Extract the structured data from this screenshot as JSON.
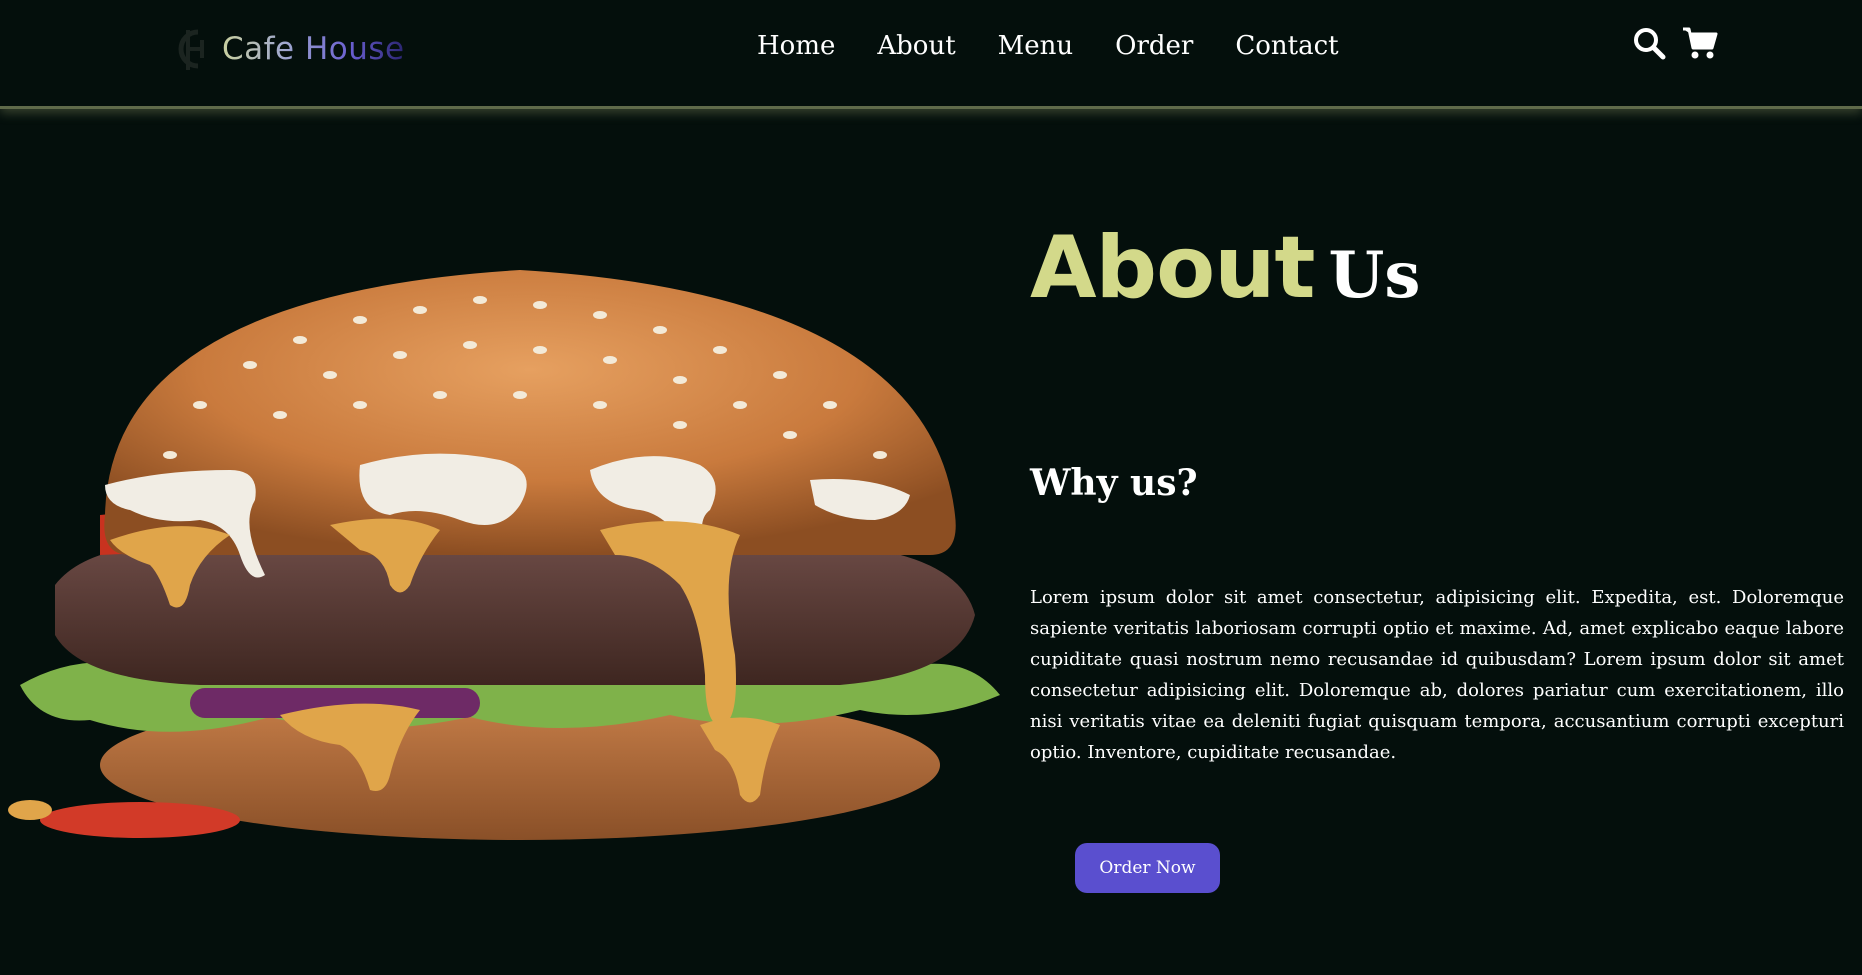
{
  "brand": {
    "name": "Cafe House"
  },
  "nav": {
    "links": [
      {
        "label": "Home"
      },
      {
        "label": "About"
      },
      {
        "label": "Menu"
      },
      {
        "label": "Order"
      },
      {
        "label": "Contact"
      }
    ],
    "icons": [
      "search-icon",
      "cart-icon"
    ]
  },
  "about": {
    "title_bold": "About",
    "title_rest": "Us",
    "subtitle": "Why us?",
    "paragraph": "Lorem ipsum dolor sit amet consectetur, adipisicing elit. Expedita, est. Doloremque sapiente veritatis laboriosam corrupti optio et maxime. Ad, amet explicabo eaque labore cupiditate quasi nostrum nemo recusandae id quibusdam? Lorem ipsum dolor sit amet consectetur adipisicing elit. Doloremque ab, dolores pariatur cum exercitationem, illo nisi veritatis vitae ea deleniti fugiat quisquam tempora, accusantium corrupti excepturi optio. Inventore, cupiditate recusandae.",
    "button_label": "Order Now"
  },
  "colors": {
    "background": "#040f0c",
    "accent": "#d3d98a",
    "button": "#5a4fcf"
  }
}
